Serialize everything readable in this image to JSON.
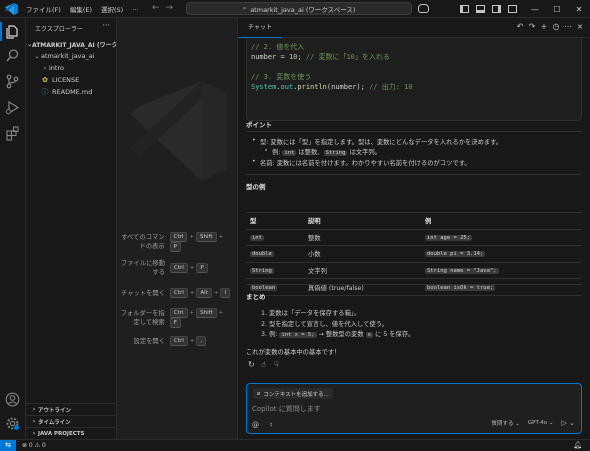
{
  "titlebar": {
    "menu": [
      "ファイル(F)",
      "編集(E)",
      "選択(S)",
      "…"
    ],
    "command_center": "atmarkit_java_ai (ワークスペース)"
  },
  "sidebar": {
    "title": "エクスプローラー",
    "root": "ATMARKIT_JAVA_AI (ワークスペ…",
    "folder": "atmarkit_java_ai",
    "items": [
      {
        "label": "intro",
        "icon": "chevron-right-icon"
      },
      {
        "label": "LICENSE",
        "icon": "license-icon"
      },
      {
        "label": "README.md",
        "icon": "info-icon"
      }
    ],
    "sections": [
      "アウトライン",
      "タイムライン",
      "JAVA PROJECTS"
    ]
  },
  "editor": {
    "shortcuts": [
      {
        "label": "すべてのコマンドの表示",
        "keys": [
          "Ctrl",
          "Shift",
          "P"
        ]
      },
      {
        "label": "ファイルに移動する",
        "keys": [
          "Ctrl",
          "P"
        ]
      },
      {
        "label": "チャットを開く",
        "keys": [
          "Ctrl",
          "Alt",
          "I"
        ]
      },
      {
        "label": "フォルダーを指定して検索",
        "keys": [
          "Ctrl",
          "Shift",
          "F"
        ]
      },
      {
        "label": "設定を開く",
        "keys": [
          "Ctrl",
          ","
        ]
      }
    ]
  },
  "chat": {
    "tab": "チャット",
    "code": {
      "c1": "// 2. 値を代入",
      "l2a": "number = ",
      "l2b": "10",
      "l2c": "; ",
      "l2d": "// 変数に「10」を入れる",
      "c3": "// 3. 変数を使う",
      "l4a": "System",
      "l4b": ".",
      "l4c": "out",
      "l4d": ".",
      "l4e": "println",
      "l4f": "(number); ",
      "l4g": "// 出力: 10"
    },
    "points_heading": "ポイント",
    "points": {
      "p1": "型: 変数には「型」を指定します。型は、変数にどんなデータを入れるかを決めます。",
      "p1a_pre": "例: ",
      "p1a_code1": "int",
      "p1a_mid": " は整数、",
      "p1a_code2": "String",
      "p1a_post": " は文字列。",
      "p2": "名前: 変数には名前を付けます。わかりやすい名前を付けるのがコツです。"
    },
    "types_heading": "型の例",
    "table": {
      "headers": [
        "型",
        "説明",
        "例"
      ],
      "rows": [
        [
          "int",
          "整数",
          "int age = 25;"
        ],
        [
          "double",
          "小数",
          "double pi = 3.14;"
        ],
        [
          "String",
          "文字列",
          "String name = \"Java\";"
        ],
        [
          "boolean",
          "真偽値 (true/false)",
          "boolean isOk = true;"
        ]
      ]
    },
    "summary_heading": "まとめ",
    "summary": {
      "s1": "1. 変数は「データを保存する箱」。",
      "s2": "2. 型を指定して宣言し、値を代入して使う。",
      "s3_pre": "3. 例: ",
      "s3_code1": "int x = 5;",
      "s3_mid": " → 整数型の変数 ",
      "s3_code2": "x",
      "s3_post": " に 5 を保存。"
    },
    "closing": "これが変数の基本中の基本です！",
    "input": {
      "context_button": "コンテキストを追加する...",
      "placeholder": "Copilot に質問します",
      "mode": "質問する ⌄",
      "model": "GPT-4o ⌄"
    }
  },
  "statusbar": {
    "problems": "⊗ 0 ⚠ 0"
  }
}
